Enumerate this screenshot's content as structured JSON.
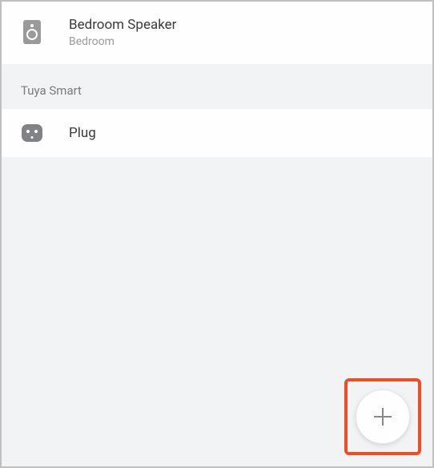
{
  "devices": {
    "speaker": {
      "title": "Bedroom  Speaker",
      "subtitle": "Bedroom"
    }
  },
  "section": {
    "header": "Tuya Smart",
    "items": [
      {
        "title": "Plug"
      }
    ]
  }
}
